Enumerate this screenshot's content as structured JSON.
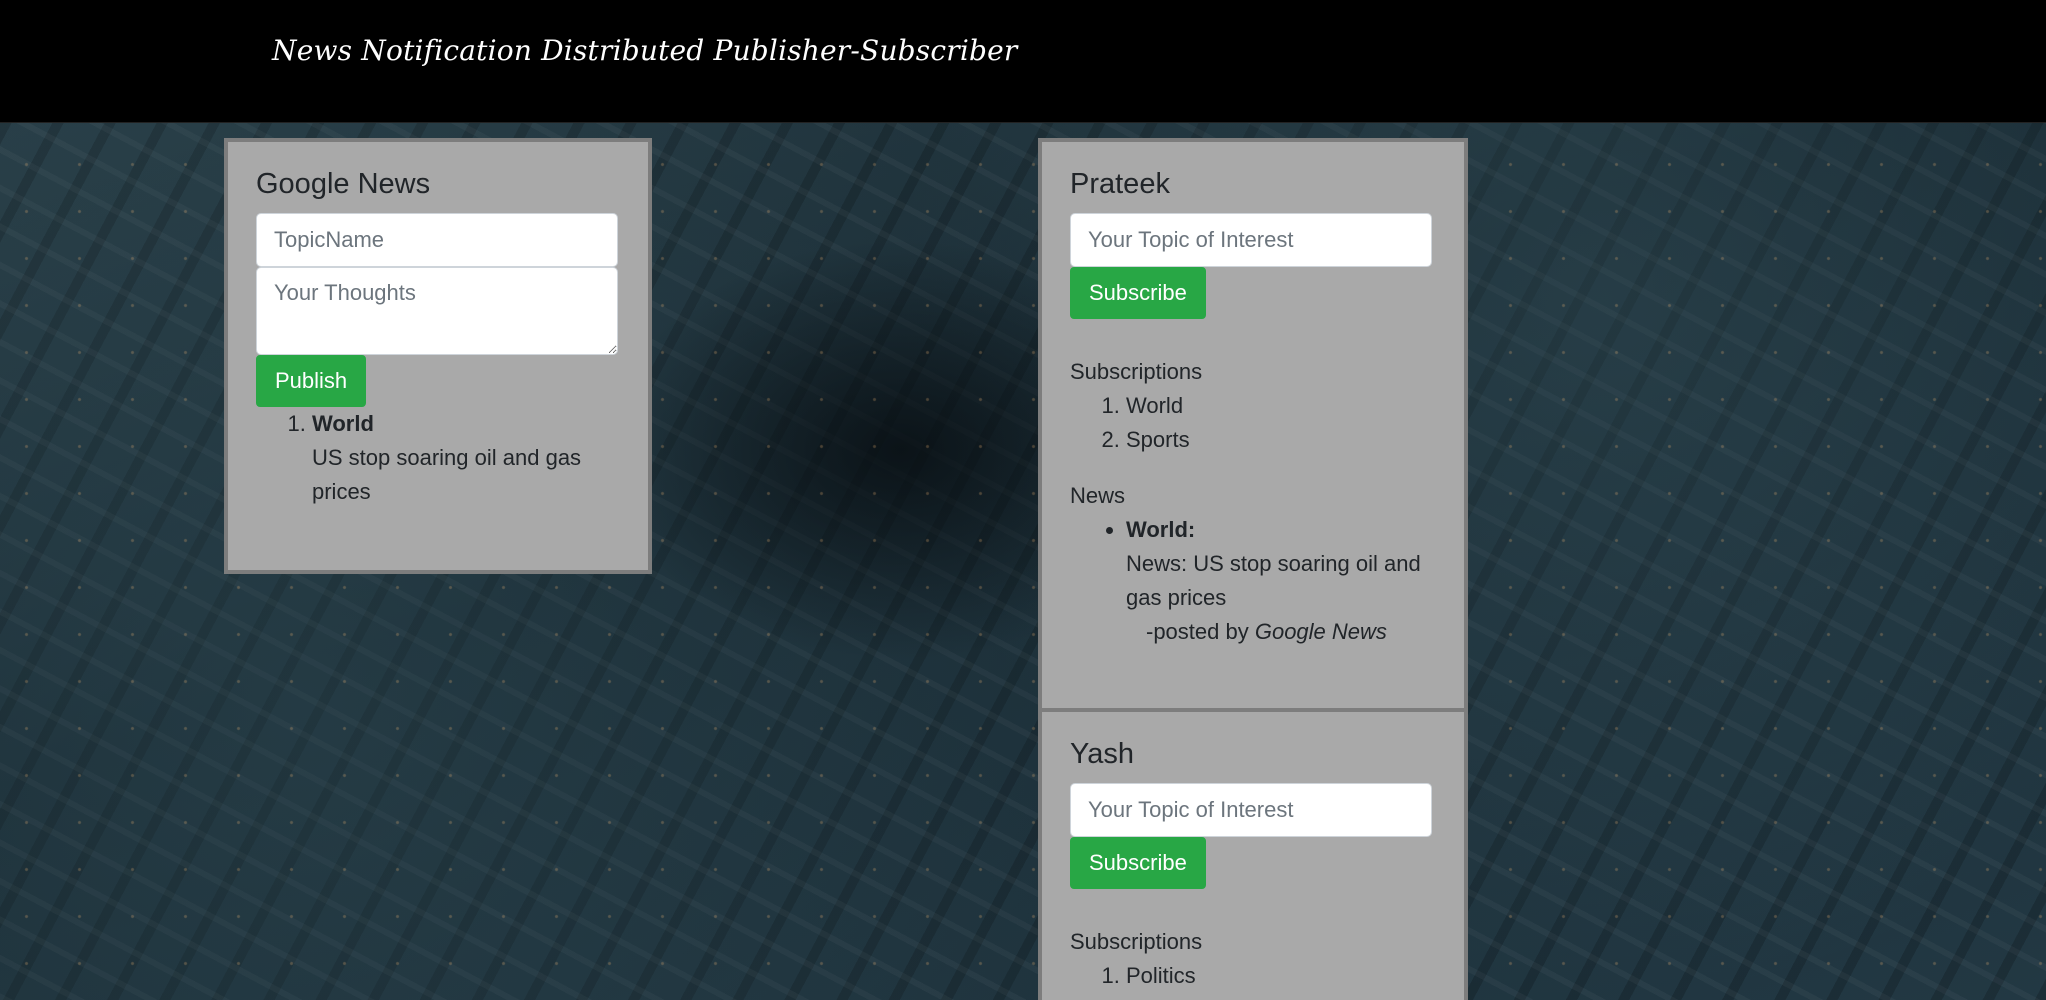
{
  "header": {
    "title": "News Notification Distributed Publisher-Subscriber"
  },
  "publisher": {
    "name": "Google News",
    "topic_placeholder": "TopicName",
    "thoughts_placeholder": "Your Thoughts",
    "publish_label": "Publish",
    "published": [
      {
        "topic": "World",
        "text": "US stop soaring oil and gas prices"
      }
    ]
  },
  "subscribers": [
    {
      "name": "Prateek",
      "topic_placeholder": "Your Topic of Interest",
      "subscribe_label": "Subscribe",
      "subscriptions_heading": "Subscriptions",
      "subscriptions": [
        "World",
        "Sports"
      ],
      "news_heading": "News",
      "news": [
        {
          "topic": "World:",
          "text": "News: US stop soaring oil and gas prices",
          "posted_prefix": "-posted by ",
          "publisher": "Google News"
        }
      ]
    },
    {
      "name": "Yash",
      "topic_placeholder": "Your Topic of Interest",
      "subscribe_label": "Subscribe",
      "subscriptions_heading": "Subscriptions",
      "subscriptions": [
        "Politics"
      ]
    }
  ],
  "colors": {
    "accent": "#28a745",
    "card": "#a9a9a9",
    "header": "#000000"
  }
}
